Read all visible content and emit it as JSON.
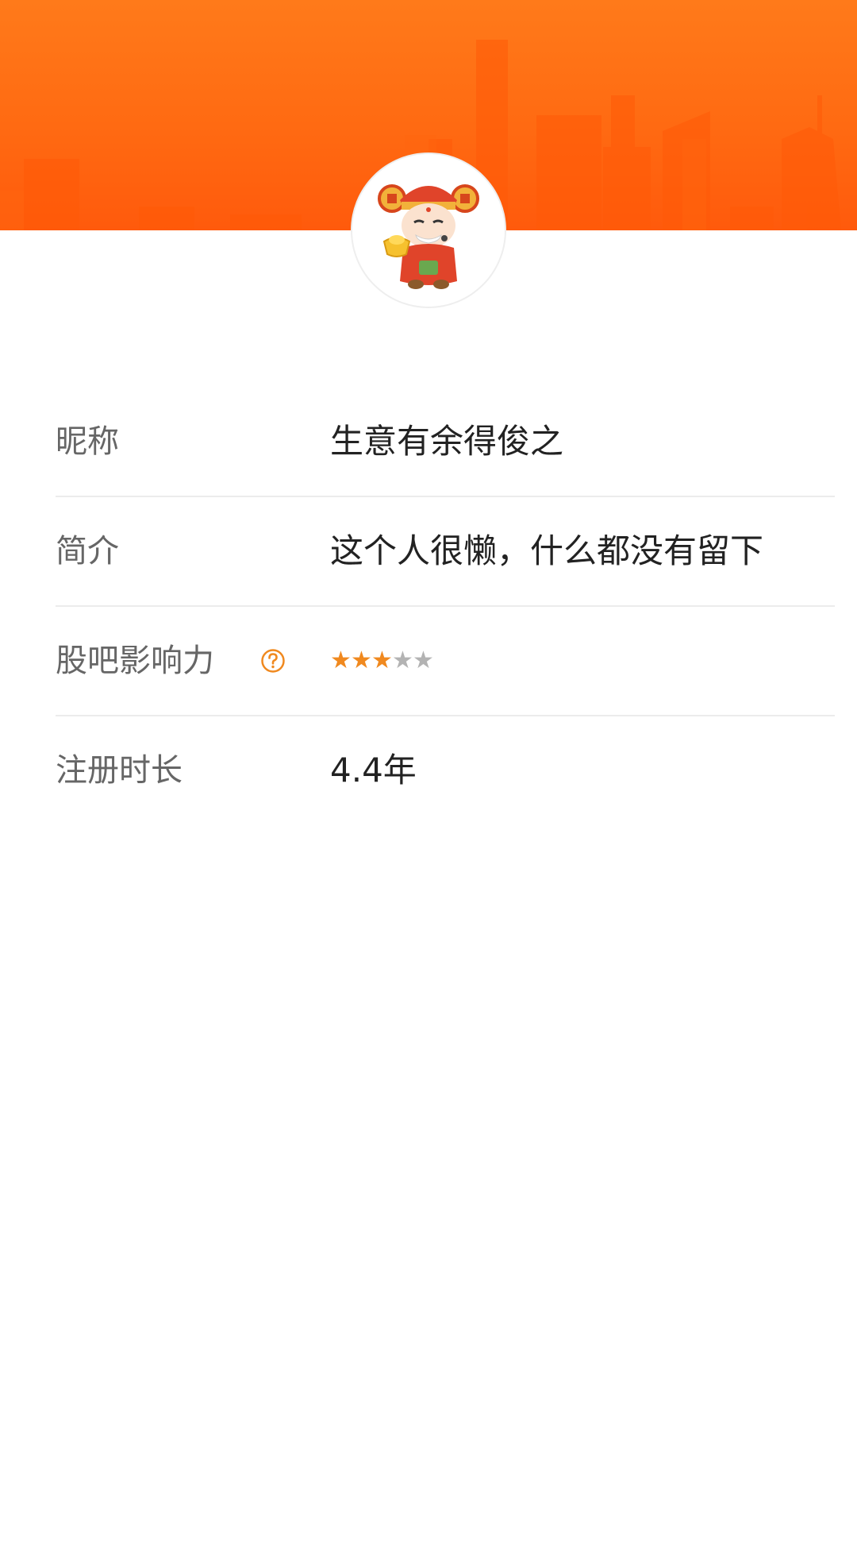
{
  "colors": {
    "accent": "#ff6a12",
    "star_on": "#f0891f",
    "star_off": "#b3b3b3",
    "label": "#666666",
    "value": "#222222"
  },
  "header": {
    "banner_icon": "city-skyline",
    "avatar_icon": "god-of-wealth-avatar"
  },
  "profile": {
    "nickname": {
      "label": "昵称",
      "value": "生意有余得俊之"
    },
    "bio": {
      "label": "简介",
      "value": "这个人很懒，什么都没有留下"
    },
    "influence": {
      "label": "股吧影响力",
      "help_icon": "question-circle-icon",
      "rating": 3,
      "max": 5
    },
    "registration": {
      "label": "注册时长",
      "value": "4.4年"
    }
  }
}
